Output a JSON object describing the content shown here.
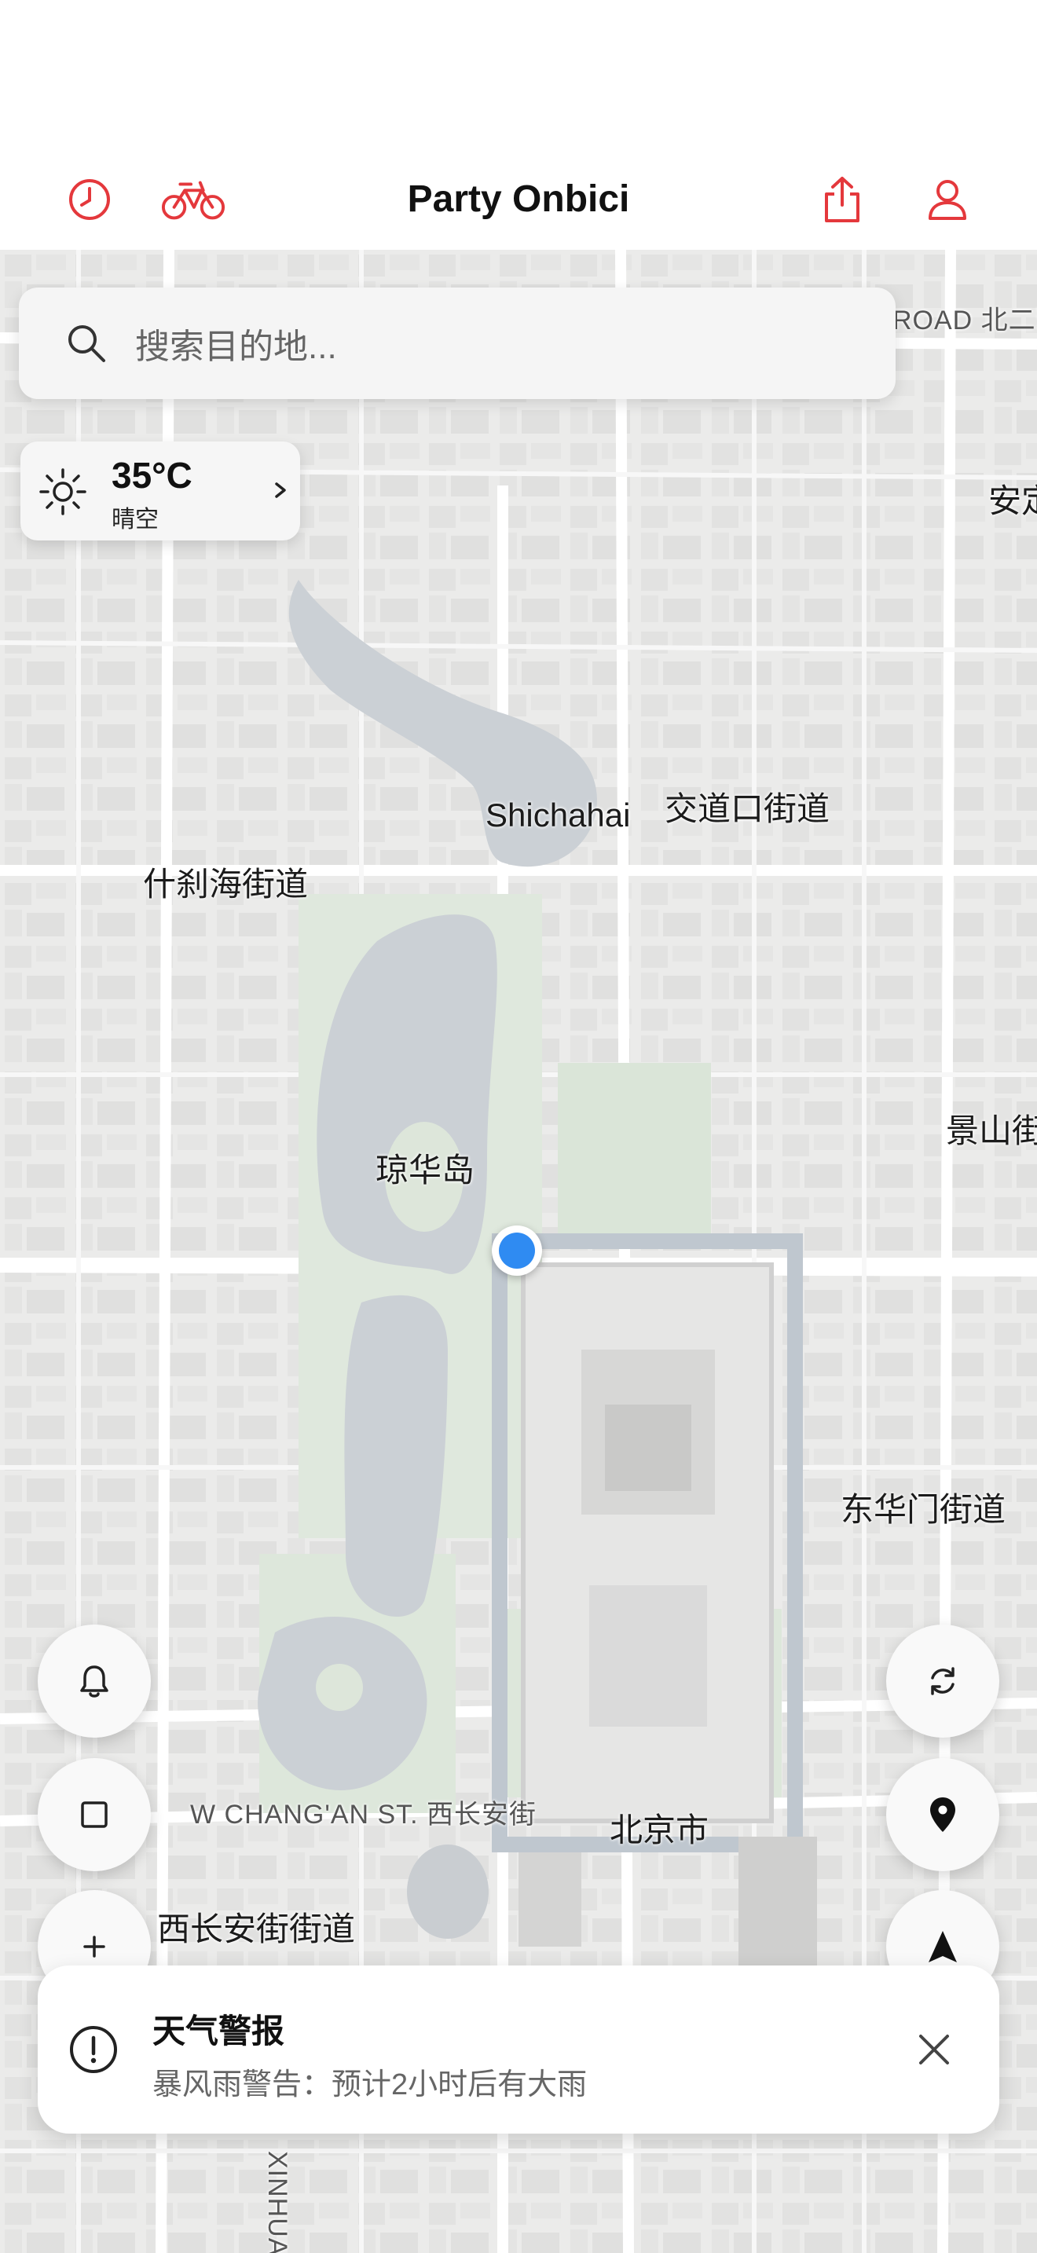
{
  "header": {
    "title": "Party Onbici",
    "left_icons": [
      "history-icon",
      "bike-icon"
    ],
    "right_icons": [
      "share-icon",
      "profile-icon"
    ],
    "accent_color": "#e4383c"
  },
  "search": {
    "placeholder": "搜索目的地..."
  },
  "weather": {
    "temperature": "35°C",
    "condition": "晴空",
    "icon": "sun-icon"
  },
  "map": {
    "labels": {
      "shichahai": "Shichahai",
      "jiaodaokou": "交道口街道",
      "shichahai_st": "什刹海街道",
      "qionghuadao": "琼华岛",
      "jingshan": "景山街",
      "donghuamen": "东华门街道",
      "changan": "W CHANG'AN ST. 西长安街",
      "beijing": "北京市",
      "xichanganjie": "西长安街街道",
      "andingmen": "安定",
      "road_ne": "ROAD 北二环",
      "xinhua": "XINHUA S"
    }
  },
  "controls": {
    "left": [
      "bell-icon",
      "square-icon",
      "plus-icon"
    ],
    "right": [
      "refresh-icon",
      "location-pin-icon",
      "navigation-arrow-icon"
    ]
  },
  "alert": {
    "title": "天气警报",
    "message": "暴风雨警告：预计2小时后有大雨",
    "icon": "alert-circle-icon"
  }
}
